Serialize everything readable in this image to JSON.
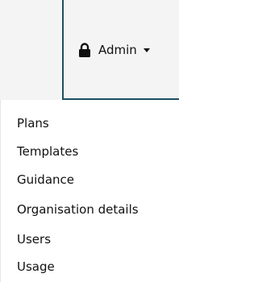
{
  "navbar": {
    "admin_label": "Admin",
    "lock_icon": "lock-icon",
    "caret_icon": "caret-down-icon",
    "accent_color": "#1d4f5e"
  },
  "dropdown": {
    "items": [
      {
        "label": "Plans"
      },
      {
        "label": "Templates"
      },
      {
        "label": "Guidance"
      },
      {
        "label": "Organisation details"
      },
      {
        "label": "Users"
      },
      {
        "label": "Usage"
      }
    ]
  }
}
